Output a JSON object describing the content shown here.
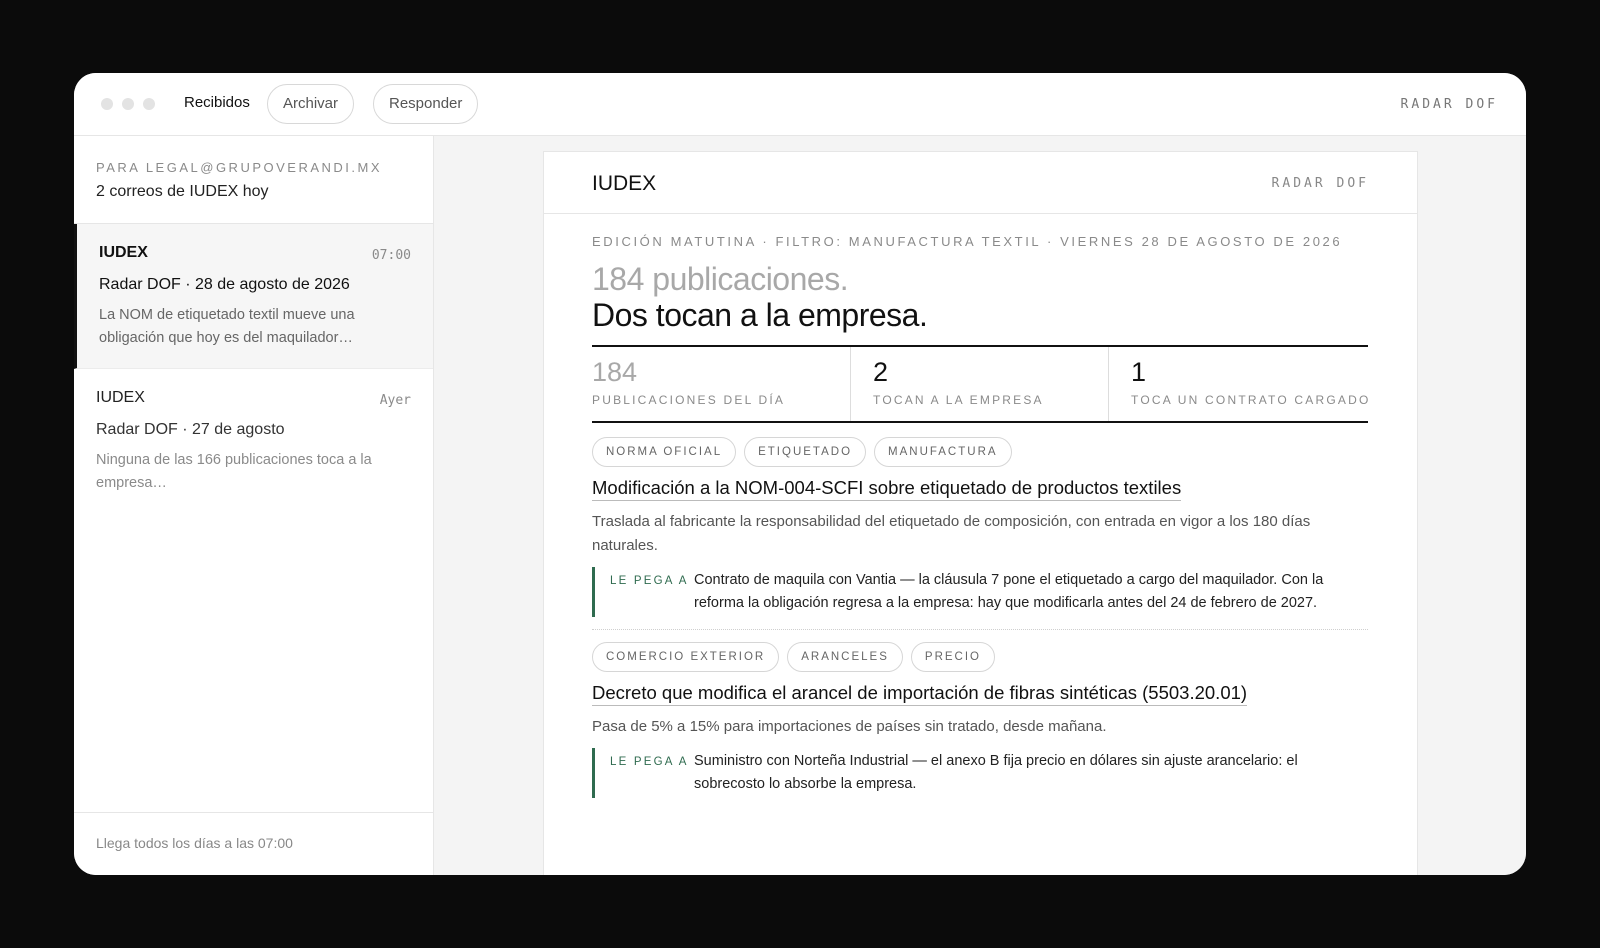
{
  "toolbar": {
    "tab_label": "Recibidos",
    "archive_label": "Archivar",
    "reply_label": "Responder",
    "brand": "RADAR DOF"
  },
  "sidebar": {
    "to": "PARA LEGAL@GRUPOVERANDI.MX",
    "count": "2 correos de IUDEX hoy",
    "mails": [
      {
        "from": "IUDEX",
        "time": "07:00",
        "subject": "Radar DOF · 28 de agosto de 2026",
        "preview": "La NOM de etiquetado textil mueve una obligación que hoy es del maquilador…"
      },
      {
        "from": "IUDEX",
        "time": "Ayer",
        "subject": "Radar DOF · 27 de agosto",
        "preview": "Ninguna de las 166 publicaciones toca a la empresa…"
      }
    ],
    "footer": "Llega todos los días a las 07:00"
  },
  "email": {
    "logo": "IUDEX",
    "brand": "RADAR DOF",
    "meta": "EDICIÓN MATUTINA · FILTRO: MANUFACTURA TEXTIL · VIERNES 28 DE AGOSTO DE 2026",
    "headline_muted": "184 publicaciones.",
    "headline": "Dos tocan a la empresa.",
    "stats": [
      {
        "value": "184",
        "label": "PUBLICACIONES DEL DÍA"
      },
      {
        "value": "2",
        "label": "TOCAN A LA EMPRESA"
      },
      {
        "value": "1",
        "label": "TOCA UN CONTRATO CARGADO"
      }
    ],
    "publications": [
      {
        "tags": [
          "NORMA OFICIAL",
          "ETIQUETADO",
          "MANUFACTURA"
        ],
        "title": "Modificación a la NOM-004-SCFI sobre etiquetado de productos textiles",
        "description": "Traslada al fabricante la responsabilidad del etiquetado de composición, con entrada en vigor a los 180 días naturales.",
        "impact_label": "LE PEGA A",
        "impact": "Contrato de maquila con Vantia — la cláusula 7 pone el etiquetado a cargo del maquilador. Con la reforma la obligación regresa a la empresa: hay que modificarla antes del 24 de febrero de 2027."
      },
      {
        "tags": [
          "COMERCIO EXTERIOR",
          "ARANCELES",
          "PRECIO"
        ],
        "title": "Decreto que modifica el arancel de importación de fibras sintéticas (5503.20.01)",
        "description": "Pasa de 5% a 15% para importaciones de países sin tratado, desde mañana.",
        "impact_label": "LE PEGA A",
        "impact": "Suministro con Norteña Industrial — el anexo B fija precio en dólares sin ajuste arancelario: el sobrecosto lo absorbe la empresa."
      }
    ]
  },
  "colors": {
    "accent": "#2f6b4f",
    "backdrop": "#0b0b0b"
  }
}
